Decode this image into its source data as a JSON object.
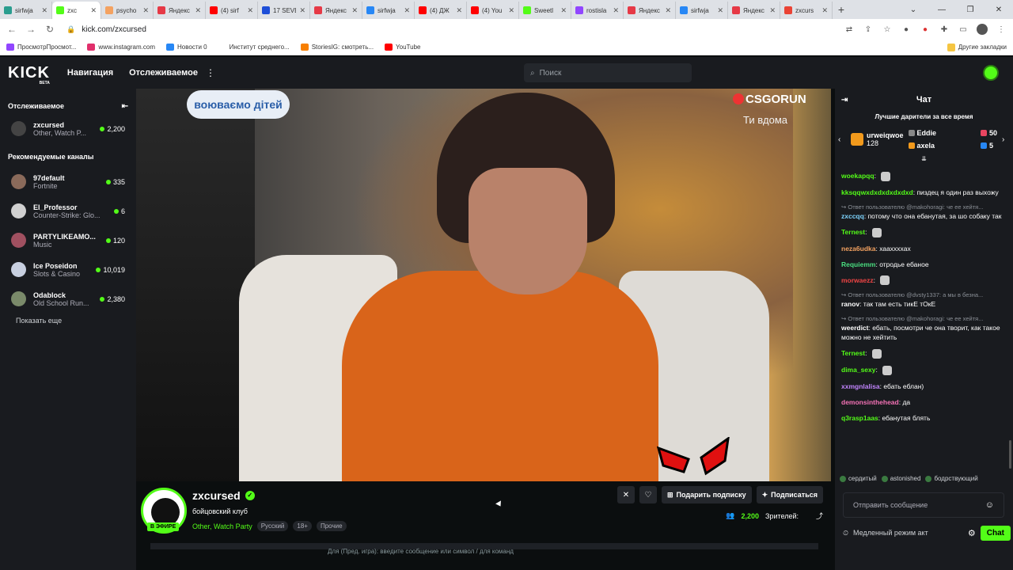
{
  "browser": {
    "tabs": [
      {
        "label": "sirfwja",
        "color": "#2a9d8f",
        "active": false
      },
      {
        "label": "zxc",
        "color": "#53fc18",
        "active": true
      },
      {
        "label": "psycho",
        "color": "#f4a261",
        "active": false
      },
      {
        "label": "Яндекс",
        "color": "#e63946",
        "active": false
      },
      {
        "label": "(4) sirf",
        "color": "#ff0000",
        "active": false
      },
      {
        "label": "17 SEVE",
        "color": "#1d4ed8",
        "active": false
      },
      {
        "label": "Яндекс",
        "color": "#e63946",
        "active": false
      },
      {
        "label": "sirfwja",
        "color": "#2787f5",
        "active": false
      },
      {
        "label": "(4) ДЖ",
        "color": "#ff0000",
        "active": false
      },
      {
        "label": "(4) You",
        "color": "#ff0000",
        "active": false
      },
      {
        "label": "Sweetl",
        "color": "#53fc18",
        "active": false
      },
      {
        "label": "rostisla",
        "color": "#9146ff",
        "active": false
      },
      {
        "label": "Яндекс",
        "color": "#e63946",
        "active": false
      },
      {
        "label": "sirfwja",
        "color": "#2787f5",
        "active": false
      },
      {
        "label": "Яндекс",
        "color": "#e63946",
        "active": false
      },
      {
        "label": "zxcurs",
        "color": "#ea4335",
        "active": false
      }
    ],
    "new_tab": "+",
    "url": "kick.com/zxcursed",
    "bookmarks": [
      {
        "label": "ПросмотрПросмот...",
        "color": "#9146ff"
      },
      {
        "label": "www.instagram.com",
        "color": "#e1306c"
      },
      {
        "label": "Новости 0",
        "color": "#2787f5"
      },
      {
        "label": "Институт среднего...",
        "color": "#ffffff"
      },
      {
        "label": "StoriesIG: смотреть...",
        "color": "#f77f00"
      },
      {
        "label": "YouTube",
        "color": "#ff0000"
      }
    ],
    "other_bookmarks": "Другие закладки"
  },
  "kick": {
    "logo": "KICK",
    "logo_sub": "BETA",
    "nav": "Навигация",
    "following": "Отслеживаемое",
    "search_placeholder": "Поиск"
  },
  "sidebar": {
    "following_title": "Отслеживаемое",
    "recommended_title": "Рекомендуемые каналы",
    "show_more": "Показать еще",
    "following": [
      {
        "name": "zxcursed",
        "game": "Other, Watch P...",
        "viewers": "2,200",
        "color": "#444"
      }
    ],
    "recommended": [
      {
        "name": "97default",
        "game": "Fortnite",
        "viewers": "335",
        "color": "#8a6a5a"
      },
      {
        "name": "El_Professor",
        "game": "Counter-Strike: Glo...",
        "viewers": "6",
        "color": "#d0d0d0"
      },
      {
        "name": "PARTYLIKEAMO...",
        "game": "Music",
        "viewers": "120",
        "color": "#a05060"
      },
      {
        "name": "Ice Poseidon",
        "game": "Slots & Casino",
        "viewers": "10,019",
        "color": "#c8d0e0"
      },
      {
        "name": "Odablock",
        "game": "Old School Run...",
        "viewers": "2,380",
        "color": "#7a8a6a"
      }
    ]
  },
  "video": {
    "sign": "воюваємо дітей",
    "overlay_logo": "CSGORUN",
    "overlay_sub": "Ти вдома"
  },
  "stream": {
    "name": "zxcursed",
    "live": "В ЭФИРЕ",
    "title": "бойцовский клуб",
    "category": "Other, Watch Party",
    "tags": [
      "Русский",
      "18+",
      "Прочие"
    ],
    "gift_btn": "Подарить подписку",
    "sub_btn": "Подписаться",
    "viewers": "2,200",
    "viewers_label": "Зрителей:",
    "game_bar_text": "Для (Пред. игра): введите сообщение или символ  /  для команд"
  },
  "chat": {
    "title": "Чат",
    "gifters_title": "Лучшие дарители за все время",
    "top_gifter": {
      "name": "urweiqwoe",
      "count": "128"
    },
    "gifters": [
      {
        "name": "Eddie",
        "count": "50",
        "color": "#e94560"
      },
      {
        "name": "axela",
        "count": "5",
        "color": "#2787f5"
      }
    ],
    "messages": [
      {
        "user": "woekapqq",
        "color": "#53fc18",
        "text": "",
        "reply": "",
        "emote": true
      },
      {
        "user": "kksqqwxdxdxdxdxdxd",
        "color": "#53fc18",
        "text": "пиздец я один раз выхожу",
        "reply": "",
        "emote": false
      },
      {
        "user": "zxccqq",
        "color": "#7dd3fc",
        "text": "потому что она ебанутая, за шо собаку так",
        "reply": "Ответ пользователю @makohoragi: че ее хейтя...",
        "emote": false
      },
      {
        "user": "Ternest",
        "color": "#53fc18",
        "text": "",
        "reply": "",
        "emote": true
      },
      {
        "user": "neza6udka",
        "color": "#f4a261",
        "text": "хааххххах",
        "reply": "",
        "emote": false
      },
      {
        "user": "Requiemm",
        "color": "#4ade80",
        "text": "отродье ебаное",
        "reply": "",
        "emote": false
      },
      {
        "user": "morwaezz",
        "color": "#ef4444",
        "text": "",
        "reply": "",
        "emote": true
      },
      {
        "user": "ranov",
        "color": "#ffffff",
        "text": "так там есть тикЕ тОкЕ",
        "reply": "Ответ пользователю @dvsty1337: а мы в безна...",
        "emote": false
      },
      {
        "user": "weerdict",
        "color": "#ffffff",
        "text": "ебать, посмотри че она творит, как такое можно не хейтить",
        "reply": "Ответ пользователю @makohoragi: че ее хейтя...",
        "emote": false
      },
      {
        "user": "Ternest",
        "color": "#53fc18",
        "text": "",
        "reply": "",
        "emote": true
      },
      {
        "user": "dima_sexy",
        "color": "#53fc18",
        "text": "",
        "reply": "",
        "emote": true
      },
      {
        "user": "xxmgnlalisa",
        "color": "#c084fc",
        "text": "ебать еблан)",
        "reply": "",
        "emote": false
      },
      {
        "user": "demonsinthehead",
        "color": "#f472b6",
        "text": "да",
        "reply": "",
        "emote": false
      },
      {
        "user": "q3rasp1aas",
        "color": "#53fc18",
        "text": "ебанутая блять",
        "reply": "",
        "emote": false
      }
    ],
    "suggestions": [
      "сердитый",
      "astonished",
      "бодрствующий"
    ],
    "input_placeholder": "Отправить сообщение",
    "slow_mode": "Медленный режим акт",
    "chat_button": "Chat"
  }
}
